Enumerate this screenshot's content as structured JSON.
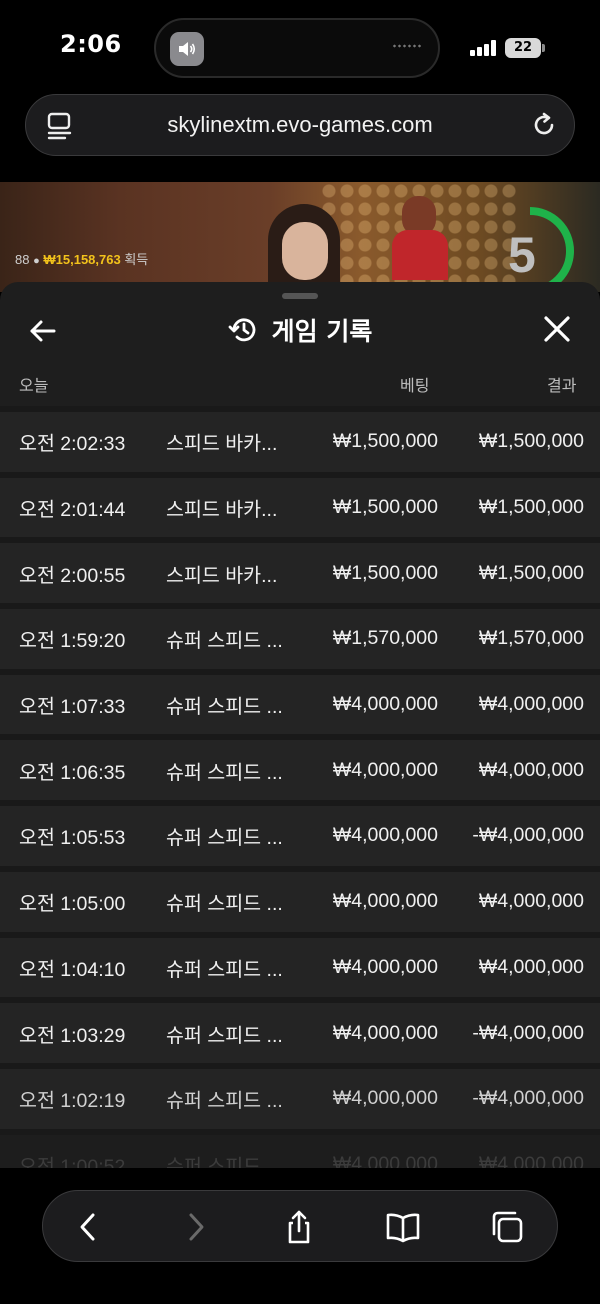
{
  "status_bar": {
    "time": "2:06",
    "battery": "22",
    "icons": [
      "speaker-icon",
      "signal-icon",
      "battery-icon"
    ]
  },
  "browser": {
    "url": "skylinextm.evo-games.com",
    "icons": [
      "reader-icon",
      "reload-icon"
    ]
  },
  "video": {
    "player_count": "88",
    "winnings": "₩15,158,763",
    "winnings_label": "획득",
    "countdown": "5"
  },
  "history": {
    "title": "게임 기록",
    "columns": {
      "date": "오늘",
      "bet": "베팅",
      "result": "결과"
    },
    "rows": [
      {
        "time": "오전 2:02:33",
        "game": "스피드 바카...",
        "bet": "₩1,500,000",
        "result": "₩1,500,000"
      },
      {
        "time": "오전 2:01:44",
        "game": "스피드 바카...",
        "bet": "₩1,500,000",
        "result": "₩1,500,000"
      },
      {
        "time": "오전 2:00:55",
        "game": "스피드 바카...",
        "bet": "₩1,500,000",
        "result": "₩1,500,000"
      },
      {
        "time": "오전 1:59:20",
        "game": "슈퍼 스피드 ...",
        "bet": "₩1,570,000",
        "result": "₩1,570,000"
      },
      {
        "time": "오전 1:07:33",
        "game": "슈퍼 스피드 ...",
        "bet": "₩4,000,000",
        "result": "₩4,000,000"
      },
      {
        "time": "오전 1:06:35",
        "game": "슈퍼 스피드 ...",
        "bet": "₩4,000,000",
        "result": "₩4,000,000"
      },
      {
        "time": "오전 1:05:53",
        "game": "슈퍼 스피드 ...",
        "bet": "₩4,000,000",
        "result": "-₩4,000,000"
      },
      {
        "time": "오전 1:05:00",
        "game": "슈퍼 스피드 ...",
        "bet": "₩4,000,000",
        "result": "₩4,000,000"
      },
      {
        "time": "오전 1:04:10",
        "game": "슈퍼 스피드 ...",
        "bet": "₩4,000,000",
        "result": "₩4,000,000"
      },
      {
        "time": "오전 1:03:29",
        "game": "슈퍼 스피드 ...",
        "bet": "₩4,000,000",
        "result": "-₩4,000,000"
      },
      {
        "time": "오전 1:02:19",
        "game": "슈퍼 스피드 ...",
        "bet": "₩4,000,000",
        "result": "-₩4,000,000"
      },
      {
        "time": "오전 1:00:52",
        "game": "슈퍼 스피드 ...",
        "bet": "₩4,000,000",
        "result": "₩4,000,000"
      }
    ]
  },
  "toolbar": {
    "icons": [
      "back-icon",
      "forward-icon",
      "share-icon",
      "bookmarks-icon",
      "tabs-icon"
    ]
  },
  "colors": {
    "sheet_bg": "#1e1e1e",
    "row_bg": "#242424",
    "winnings_gold": "#f2c21b",
    "countdown_green": "#1fb24a"
  }
}
